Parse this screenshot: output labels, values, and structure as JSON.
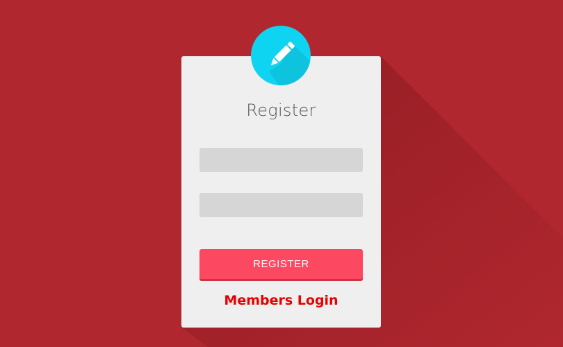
{
  "colors": {
    "background": "#b0272f",
    "card": "#efefef",
    "input": "#d6d6d6",
    "button": "#fd4861",
    "badge": "#0fd4f1",
    "members_login": "#e60000"
  },
  "badge": {
    "icon": "pencil-icon"
  },
  "form": {
    "title": "Register",
    "field_1": {
      "value": "",
      "placeholder": ""
    },
    "field_2": {
      "value": "",
      "placeholder": ""
    },
    "register_label": "REGISTER"
  },
  "footer": {
    "members_login_label": "Members Login"
  }
}
